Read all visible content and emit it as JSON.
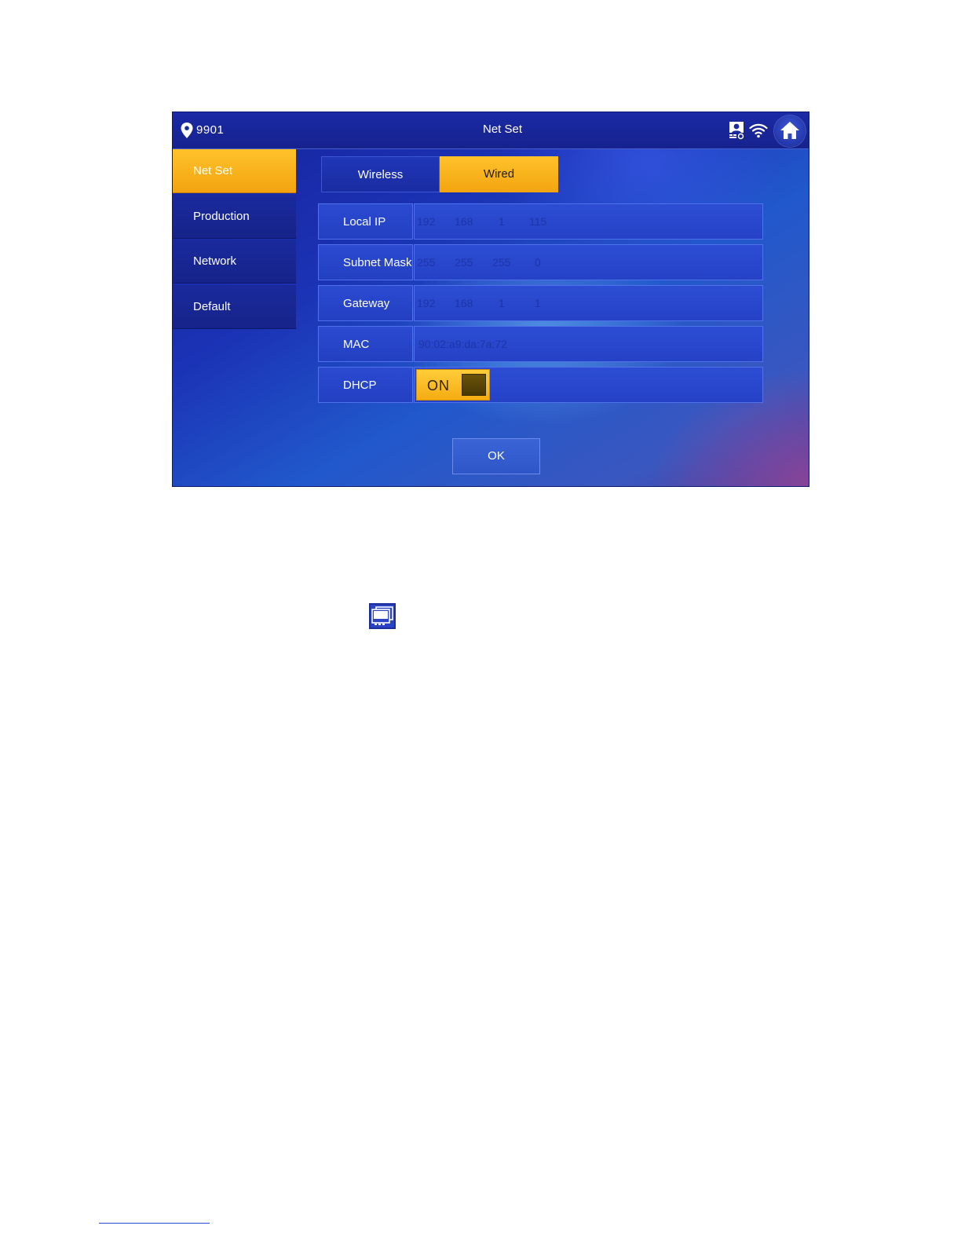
{
  "topbar": {
    "room_number": "9901",
    "title": "Net Set"
  },
  "sidebar": {
    "items": [
      {
        "label": "Net Set",
        "active": true
      },
      {
        "label": "Production",
        "active": false
      },
      {
        "label": "Network",
        "active": false
      },
      {
        "label": "Default",
        "active": false
      }
    ]
  },
  "tabs": [
    {
      "label": "Wireless",
      "active": false
    },
    {
      "label": "Wired",
      "active": true
    }
  ],
  "fields": {
    "local_ip": {
      "label": "Local IP",
      "octets": [
        "192",
        "168",
        "1",
        "115"
      ]
    },
    "subnet_mask": {
      "label": "Subnet Mask",
      "octets": [
        "255",
        "255",
        "255",
        "0"
      ]
    },
    "gateway": {
      "label": "Gateway",
      "octets": [
        "192",
        "168",
        "1",
        "1"
      ]
    },
    "mac": {
      "label": "MAC",
      "value": "90:02:a9:da:7a:72"
    },
    "dhcp": {
      "label": "DHCP",
      "state": "ON"
    }
  },
  "ok_label": "OK",
  "icons": {
    "location": "location-pin-icon",
    "camera": "intercom-camera-icon",
    "wifi": "wifi-icon",
    "home": "home-icon",
    "monitor": "monitor-icon"
  },
  "colors": {
    "accent": "#f2a410",
    "screen_blue": "#1b33b6",
    "topbar": "#16228d"
  }
}
